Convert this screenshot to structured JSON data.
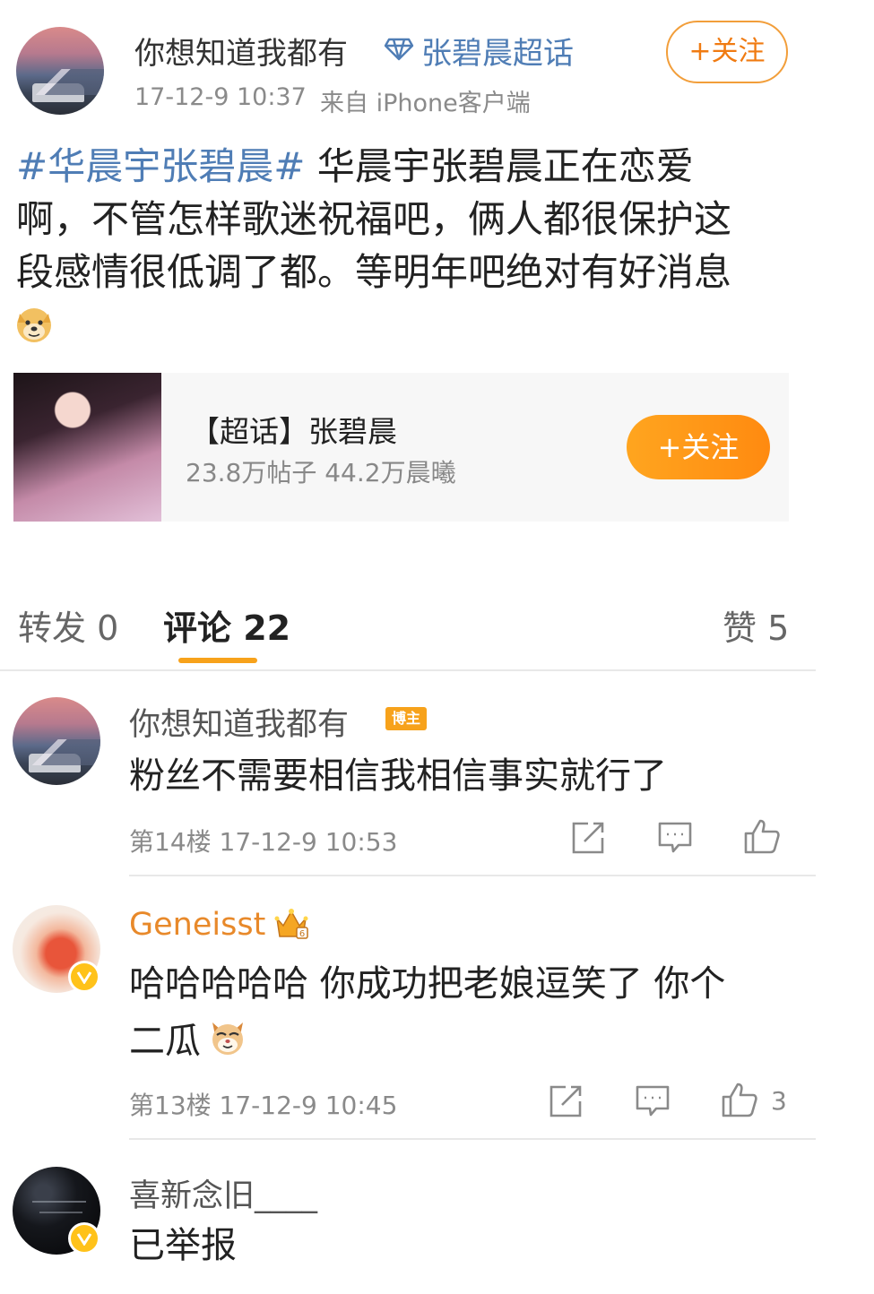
{
  "post": {
    "author": "你想知道我都有",
    "supertopic_link": "张碧晨超话",
    "follow_label": "+关注",
    "timestamp": "17-12-9 10:37",
    "source": "来自 iPhone客户端",
    "hashtag": "#华晨宇张碧晨#",
    "body_line1": " 华晨宇张碧晨正在恋爱",
    "body_line2": "啊，不管怎样歌迷祝福吧，俩人都很保护这",
    "body_line3": "段感情很低调了都。等明年吧绝对有好消息",
    "emoji": "doge-emoji-icon"
  },
  "card": {
    "title": "【超话】张碧晨",
    "stats": "23.8万帖子 44.2万晨曦",
    "follow_label": "+关注"
  },
  "tabs": {
    "repost": "转发 0",
    "comments": "评论 22",
    "likes": "赞 5"
  },
  "comments": [
    {
      "author": "你想知道我都有",
      "badge": "博主",
      "text": "粉丝不需要相信我相信事实就行了",
      "meta": "第14楼 17-12-9 10:53",
      "like_count": ""
    },
    {
      "author": "Geneisst",
      "text_line1": "哈哈哈哈哈 你成功把老娘逗笑了 你个",
      "text_line2": "二瓜",
      "meta": "第13楼 17-12-9 10:45",
      "like_count": "3"
    },
    {
      "author": "喜新念旧____",
      "text": "已举报"
    }
  ],
  "colors": {
    "accent_orange": "#f7a21b",
    "link_blue": "#4f7db5"
  }
}
